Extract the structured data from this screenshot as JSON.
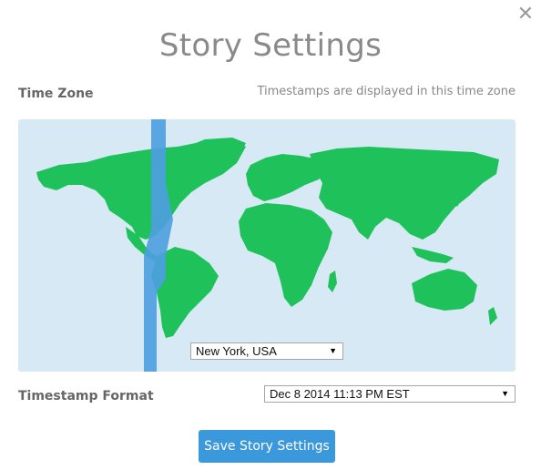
{
  "dialog": {
    "title": "Story Settings",
    "close_icon": "close-x-icon"
  },
  "time_zone": {
    "label": "Time Zone",
    "hint": "Timestamps are displayed in this time zone",
    "selected": "New York, USA"
  },
  "timestamp_format": {
    "label": "Timestamp Format",
    "selected": "Dec 8 2014 11:13 PM EST"
  },
  "actions": {
    "save_label": "Save Story Settings"
  },
  "colors": {
    "ocean": "#d7e9f5",
    "land": "#1fc25a",
    "timezone_band": "#4c9ee0",
    "save_button": "#3b98db"
  }
}
